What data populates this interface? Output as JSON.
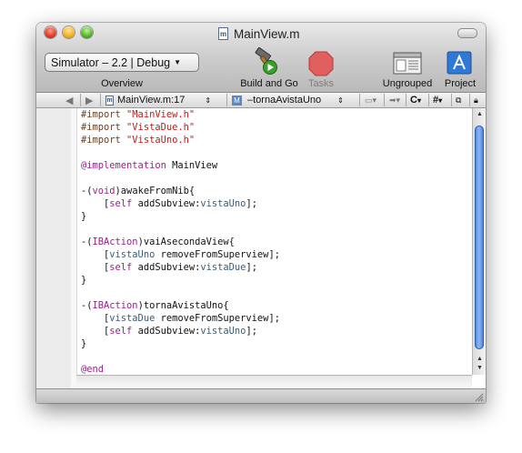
{
  "window": {
    "title": "MainView.m",
    "file_icon_letter": "m"
  },
  "toolbar": {
    "overview_popup_value": "Simulator – 2.2 | Debug",
    "overview_label": "Overview",
    "build_go_label": "Build and Go",
    "tasks_label": "Tasks",
    "ungrouped_label": "Ungrouped",
    "project_label": "Project"
  },
  "navbar": {
    "file_label": "MainView.m:17",
    "method_icon_letter": "M",
    "method_label": "–tornaAvistaUno",
    "c_label": "C",
    "hash_label": "#"
  },
  "code": {
    "lines": [
      {
        "parts": [
          {
            "t": "#import ",
            "c": "pp"
          },
          {
            "t": "\"MainView.h\"",
            "c": "str"
          }
        ]
      },
      {
        "parts": [
          {
            "t": "#import ",
            "c": "pp"
          },
          {
            "t": "\"VistaDue.h\"",
            "c": "str"
          }
        ]
      },
      {
        "parts": [
          {
            "t": "#import ",
            "c": "pp"
          },
          {
            "t": "\"VistaUno.h\"",
            "c": "str"
          }
        ]
      },
      {
        "parts": []
      },
      {
        "parts": [
          {
            "t": "@implementation",
            "c": "kw"
          },
          {
            "t": " MainView",
            "c": ""
          }
        ]
      },
      {
        "parts": []
      },
      {
        "parts": [
          {
            "t": "-(",
            "c": ""
          },
          {
            "t": "void",
            "c": "kw"
          },
          {
            "t": ")awakeFromNib{",
            "c": ""
          }
        ]
      },
      {
        "parts": [
          {
            "t": "    [",
            "c": ""
          },
          {
            "t": "self",
            "c": "kw"
          },
          {
            "t": " addSubview:",
            "c": ""
          },
          {
            "t": "vistaUno",
            "c": "cls"
          },
          {
            "t": "];",
            "c": ""
          }
        ]
      },
      {
        "parts": [
          {
            "t": "}",
            "c": ""
          }
        ]
      },
      {
        "parts": []
      },
      {
        "parts": [
          {
            "t": "-(",
            "c": ""
          },
          {
            "t": "IBAction",
            "c": "kw"
          },
          {
            "t": ")vaiAsecondaView{",
            "c": ""
          }
        ]
      },
      {
        "parts": [
          {
            "t": "    [",
            "c": ""
          },
          {
            "t": "vistaUno",
            "c": "cls"
          },
          {
            "t": " removeFromSuperview];",
            "c": ""
          }
        ]
      },
      {
        "parts": [
          {
            "t": "    [",
            "c": ""
          },
          {
            "t": "self",
            "c": "kw"
          },
          {
            "t": " addSubview:",
            "c": ""
          },
          {
            "t": "vistaDue",
            "c": "cls"
          },
          {
            "t": "];",
            "c": ""
          }
        ]
      },
      {
        "parts": [
          {
            "t": "}",
            "c": ""
          }
        ]
      },
      {
        "parts": []
      },
      {
        "parts": [
          {
            "t": "-(",
            "c": ""
          },
          {
            "t": "IBAction",
            "c": "kw"
          },
          {
            "t": ")tornaAvistaUno{",
            "c": ""
          }
        ]
      },
      {
        "parts": [
          {
            "t": "    [",
            "c": ""
          },
          {
            "t": "vistaDue",
            "c": "cls"
          },
          {
            "t": " removeFromSuperview];",
            "c": ""
          }
        ]
      },
      {
        "parts": [
          {
            "t": "    [",
            "c": ""
          },
          {
            "t": "self",
            "c": "kw"
          },
          {
            "t": " addSubview:",
            "c": ""
          },
          {
            "t": "vistaUno",
            "c": "cls"
          },
          {
            "t": "];",
            "c": ""
          }
        ]
      },
      {
        "parts": [
          {
            "t": "}",
            "c": ""
          }
        ]
      },
      {
        "parts": []
      },
      {
        "parts": [
          {
            "t": "@end",
            "c": "kw"
          }
        ]
      }
    ]
  },
  "colors": {
    "keyword": "#9b1f8d",
    "string": "#c41a16",
    "preprocessor": "#6b3f20",
    "identifier": "#3b5c78"
  }
}
